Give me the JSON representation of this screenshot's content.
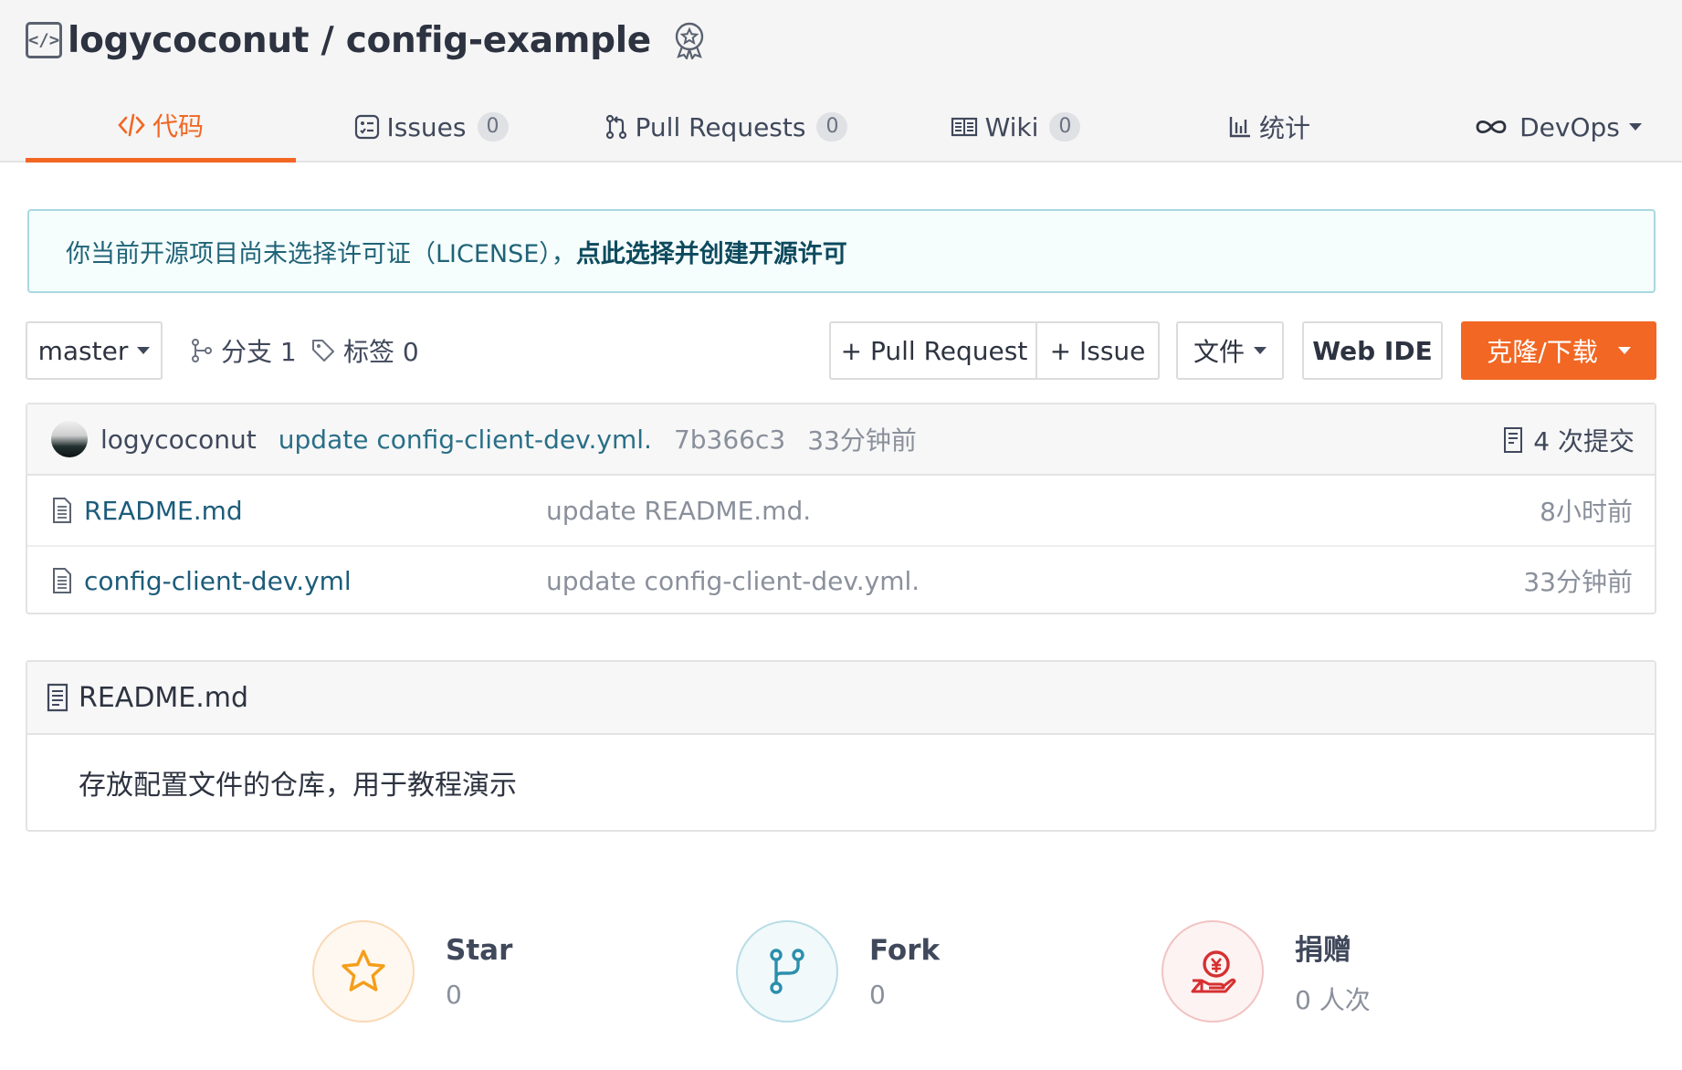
{
  "repo": {
    "title": "logycoconut / config-example"
  },
  "tabs": [
    {
      "label": "代码",
      "count": null
    },
    {
      "label": "Issues",
      "count": "0"
    },
    {
      "label": "Pull Requests",
      "count": "0"
    },
    {
      "label": "Wiki",
      "count": "0"
    },
    {
      "label": "统计",
      "count": null
    },
    {
      "label": "DevOps",
      "count": null
    }
  ],
  "notice": {
    "text": "你当前开源项目尚未选择许可证（LICENSE），",
    "link": "点此选择并创建开源许可"
  },
  "toolbar": {
    "branch": "master",
    "branches": "分支 1",
    "tags": "标签 0",
    "pull_request": "+ Pull Request",
    "issue": "+ Issue",
    "file": "文件",
    "web_ide": "Web IDE",
    "clone": "克隆/下载"
  },
  "commit": {
    "user": "logycoconut",
    "message": "update config-client-dev.yml.",
    "sha": "7b366c3",
    "time": "33分钟前",
    "count": "4 次提交"
  },
  "files": [
    {
      "name": "README.md",
      "message": "update README.md.",
      "time": "8小时前"
    },
    {
      "name": "config-client-dev.yml",
      "message": "update config-client-dev.yml.",
      "time": "33分钟前"
    }
  ],
  "readme": {
    "title": "README.md",
    "content": "存放配置文件的仓库，用于教程演示"
  },
  "stats": {
    "star": {
      "title": "Star",
      "value": "0"
    },
    "fork": {
      "title": "Fork",
      "value": "0"
    },
    "donate": {
      "title": "捐赠",
      "value": "0 人次"
    }
  },
  "colors": {
    "accent": "#f16723",
    "link": "#1c5c7a"
  }
}
